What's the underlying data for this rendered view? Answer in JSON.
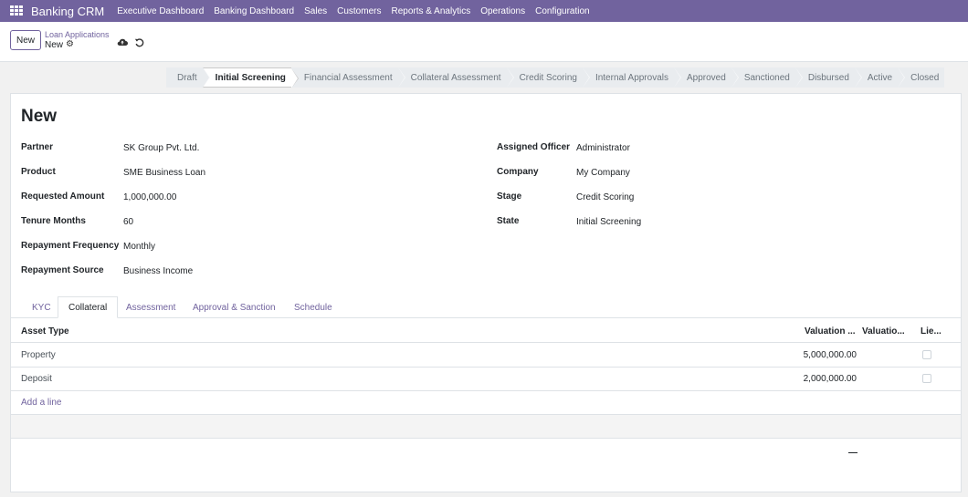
{
  "nav": {
    "brand": "Banking CRM",
    "menu": [
      "Executive Dashboard",
      "Banking Dashboard",
      "Sales",
      "Customers",
      "Reports & Analytics",
      "Operations",
      "Configuration"
    ]
  },
  "control": {
    "new_label": "New",
    "breadcrumb": "Loan Applications",
    "record": "New"
  },
  "statusbar": {
    "stages": [
      "Draft",
      "Initial Screening",
      "Financial Assessment",
      "Collateral Assessment",
      "Credit Scoring",
      "Internal Approvals",
      "Approved",
      "Sanctioned",
      "Disbursed",
      "Active",
      "Closed"
    ],
    "active": "Initial Screening"
  },
  "form": {
    "title": "New",
    "left": [
      {
        "label": "Partner",
        "value": "SK Group Pvt. Ltd."
      },
      {
        "label": "Product",
        "value": "SME Business Loan"
      },
      {
        "label": "Requested Amount",
        "value": "1,000,000.00"
      },
      {
        "label": "Tenure Months",
        "value": "60"
      },
      {
        "label": "Repayment Frequency",
        "value": "Monthly"
      },
      {
        "label": "Repayment Source",
        "value": "Business Income"
      }
    ],
    "right": [
      {
        "label": "Assigned Officer",
        "value": "Administrator"
      },
      {
        "label": "Company",
        "value": "My Company"
      },
      {
        "label": "Stage",
        "value": "Credit Scoring"
      },
      {
        "label": "State",
        "value": "Initial Screening"
      }
    ]
  },
  "tabs": {
    "items": [
      "KYC",
      "Collateral",
      "Assessment",
      "Approval & Sanction",
      "Schedule"
    ],
    "active": "Collateral"
  },
  "collateral": {
    "headers": {
      "asset_type": "Asset Type",
      "valuation_amount": "Valuation ...",
      "valuation_other": "Valuatio...",
      "lien": "Lie..."
    },
    "rows": [
      {
        "asset_type": "Property",
        "valuation": "5,000,000.00",
        "lien": false
      },
      {
        "asset_type": "Deposit",
        "valuation": "2,000,000.00",
        "lien": false
      }
    ],
    "add_line": "Add a line",
    "footer_total": "—"
  },
  "colors": {
    "accent": "#71639e"
  },
  "icons": [
    "apps-grid-icon",
    "gear-icon",
    "cloud-upload-icon",
    "undo-icon"
  ]
}
